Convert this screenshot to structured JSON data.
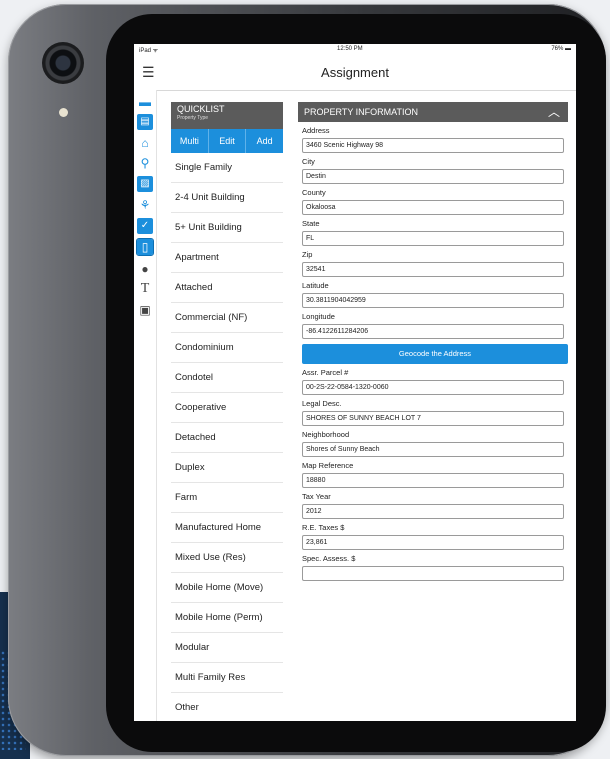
{
  "status_bar": {
    "carrier": "iPad ᯤ",
    "time": "12:50 PM",
    "battery": "76% ▬"
  },
  "nav": {
    "menu_icon": "hamburger-icon",
    "title": "Assignment"
  },
  "rail_icons": [
    "briefcase-icon",
    "document-icon",
    "house-icon",
    "location-pin-icon",
    "photo-icon",
    "tree-icon",
    "checkbox-icon",
    "tablet-icon",
    "microphone-icon",
    "text-icon",
    "save-icon"
  ],
  "quicklist": {
    "title": "QUICKLIST",
    "subtitle": "Property Type",
    "buttons": [
      "Multi",
      "Edit",
      "Add"
    ],
    "items": [
      "Single Family",
      "2-4 Unit Building",
      "5+ Unit Building",
      "Apartment",
      "Attached",
      "Commercial (NF)",
      "Condominium",
      "Condotel",
      "Cooperative",
      "Detached",
      "Duplex",
      "Farm",
      "Manufactured Home",
      "Mixed Use (Res)",
      "Mobile Home (Move)",
      "Mobile Home (Perm)",
      "Modular",
      "Multi Family Res",
      "Other"
    ]
  },
  "property": {
    "header": "PROPERTY INFORMATION",
    "fields_top": [
      {
        "label": "Address",
        "value": "3460 Scenic Highway 98"
      },
      {
        "label": "City",
        "value": "Destin"
      },
      {
        "label": "County",
        "value": "Okaloosa"
      },
      {
        "label": "State",
        "value": "FL"
      },
      {
        "label": "Zip",
        "value": "32541"
      },
      {
        "label": "Latitude",
        "value": "30.3811904042959"
      },
      {
        "label": "Longitude",
        "value": "-86.4122611284206"
      }
    ],
    "geocode_label": "Geocode the Address",
    "fields_bottom": [
      {
        "label": "Assr. Parcel #",
        "value": "00-2S-22-0584-1320-0060"
      },
      {
        "label": "Legal Desc.",
        "value": "SHORES OF SUNNY BEACH LOT 7"
      },
      {
        "label": "Neighborhood",
        "value": "Shores of Sunny Beach"
      },
      {
        "label": "Map Reference",
        "value": "18880"
      },
      {
        "label": "Tax Year",
        "value": "2012"
      },
      {
        "label": "R.E. Taxes $",
        "value": "23,861"
      },
      {
        "label": "Spec. Assess. $",
        "value": ""
      }
    ]
  },
  "colors": {
    "accent": "#1c8fdc",
    "header_gray": "#5b5b5b"
  }
}
